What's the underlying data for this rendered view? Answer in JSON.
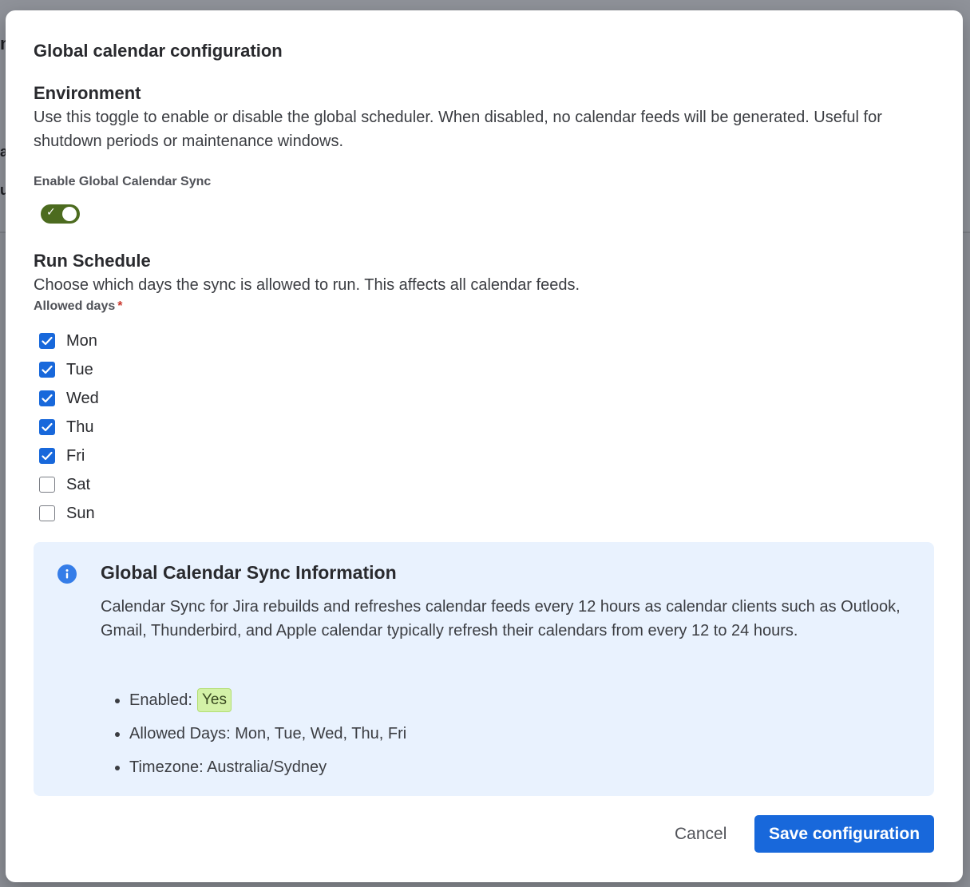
{
  "modal": {
    "title": "Global calendar configuration"
  },
  "environment": {
    "title": "Environment",
    "description": "Use this toggle to enable or disable the global scheduler. When disabled, no calendar feeds will be generated. Useful for shutdown periods or maintenance windows.",
    "toggle_label": "Enable Global Calendar Sync",
    "toggle_on": true,
    "toggle_check_glyph": "✓"
  },
  "schedule": {
    "title": "Run Schedule",
    "description": "Choose which days the sync is allowed to run. This affects all calendar feeds.",
    "field_label": "Allowed days",
    "required_marker": "*",
    "days": [
      {
        "label": "Mon",
        "checked": true
      },
      {
        "label": "Tue",
        "checked": true
      },
      {
        "label": "Wed",
        "checked": true
      },
      {
        "label": "Thu",
        "checked": true
      },
      {
        "label": "Fri",
        "checked": true
      },
      {
        "label": "Sat",
        "checked": false
      },
      {
        "label": "Sun",
        "checked": false
      }
    ]
  },
  "info": {
    "icon": "info-icon",
    "title": "Global Calendar Sync Information",
    "body": "Calendar Sync for Jira rebuilds and refreshes calendar feeds every 12 hours as calendar clients such as Outlook, Gmail, Thunderbird, and Apple calendar typically refresh their calendars from every 12 to 24 hours.",
    "enabled_label": "Enabled:",
    "enabled_value": "Yes",
    "allowed_days_text": "Allowed Days: Mon, Tue, Wed, Thu, Fri",
    "timezone_text": "Timezone: Australia/Sydney"
  },
  "footer": {
    "cancel_label": "Cancel",
    "save_label": "Save configuration"
  },
  "colors": {
    "primary": "#1868db",
    "toggle_on": "#4c6b1f",
    "info_bg": "#e9f2fe",
    "badge_bg": "#d3f1a7",
    "required": "#c9372c"
  },
  "background": {
    "fragments": [
      "n",
      "a",
      "u"
    ]
  }
}
